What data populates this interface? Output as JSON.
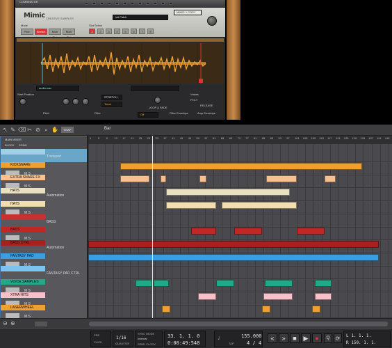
{
  "rack": {
    "combinator": "COMBINATOR",
    "combinator_sub": "Combi 1",
    "logo": "Mimic",
    "logo_sub": "CREATIVE SAMPLER",
    "patch": "init Patch",
    "device_name": "MIMIC 1 COPY",
    "mode_label": "Mode",
    "slot_select_label": "Slot Select",
    "modes": [
      "Pitch",
      "Stretch",
      "Multi Slot",
      "Multi Slot"
    ],
    "slots": [
      "1",
      "2",
      "3",
      "4",
      "5",
      "6",
      "7",
      "8"
    ],
    "sample_name": "audio.wav",
    "stretch_label": "STRETCH",
    "stretch_mode": "Tonal",
    "start_position": "Start Position",
    "voices": "Voices",
    "pitch": "Pitch",
    "filter": "Filter",
    "filter_mode": "Off",
    "filter_env": "Filter Envelope",
    "amp_env": "Amp Envelope",
    "loop_fade": "LOOP & FADE",
    "poly": "POLY",
    "release": "RELEASE"
  },
  "toolbar": {
    "bar_label": "Bar",
    "snap": "SNAP"
  },
  "lanes_header": {
    "title": "MAIN MIXER",
    "block": "BLOCK",
    "song": "SONG"
  },
  "ruler": [
    "1",
    "5",
    "9",
    "13",
    "17",
    "21",
    "25",
    "29",
    "33",
    "37",
    "41",
    "45",
    "49",
    "53",
    "57",
    "61",
    "65",
    "69",
    "73",
    "77",
    "81",
    "85",
    "89",
    "93",
    "97",
    "101",
    "105",
    "109",
    "113",
    "117",
    "121",
    "125",
    "129",
    "133",
    "137",
    "141",
    "145"
  ],
  "tracks": [
    {
      "name": "",
      "lane": "Transport",
      "color": "#9fd0e8",
      "kind": "transport"
    },
    {
      "name": "KICKSNARE",
      "lane": "",
      "color": "#f0a030",
      "kind": "inst"
    },
    {
      "name": "EXTRA SNARE FX",
      "lane": "",
      "color": "#f7c090",
      "kind": "inst"
    },
    {
      "name": "HATS",
      "lane": "Automation",
      "color": "#e8e0c0",
      "kind": "auto"
    },
    {
      "name": "HATS",
      "lane": "",
      "color": "#f2ddb0",
      "kind": "inst"
    },
    {
      "name": "",
      "lane": "BASS",
      "color": "#c93030",
      "kind": "sub"
    },
    {
      "name": "BASS",
      "lane": "",
      "color": "#c02828",
      "kind": "inst"
    },
    {
      "name": "BASS CTRL",
      "lane": "Automation",
      "color": "#a82020",
      "kind": "auto"
    },
    {
      "name": "FANTASY PAD",
      "lane": "",
      "color": "#3a9ee0",
      "kind": "inst"
    },
    {
      "name": "",
      "lane": "FANTASY PAD CTRL",
      "color": "#7bc4f0",
      "kind": "sub"
    },
    {
      "name": "VOICE SAMPLES",
      "lane": "",
      "color": "#22aa88",
      "kind": "inst"
    },
    {
      "name": "XTRA HITS",
      "lane": "",
      "color": "#f8c0c8",
      "kind": "inst"
    },
    {
      "name": "LASERWHEEL",
      "lane": "",
      "color": "#f0a030",
      "kind": "inst"
    }
  ],
  "transport": {
    "pre": "PRE",
    "click": "CLICK",
    "sync_mode": "SYNC MODE",
    "sync": "Internal",
    "sync_btn": "SEND CLOCK",
    "quantize": "1/16",
    "quantize_label": "QUANTIZE",
    "position_bars": "33. 1. 1.   0",
    "position_time": "0:00:49:548",
    "tempo": "155.000",
    "signature": "4 / 4",
    "tap": "TAP",
    "left_loc": "L  1. 1. 1.",
    "right_loc": "R  150. 1. 1."
  },
  "colors": {
    "accent": "#f0a030",
    "selected": "#3d6ea0"
  }
}
